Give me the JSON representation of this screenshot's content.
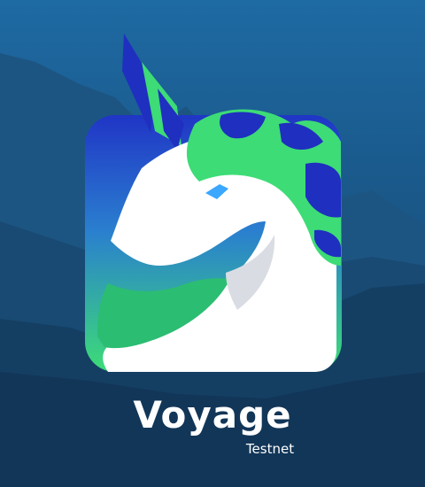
{
  "app": {
    "name": "Voyage",
    "subtitle": "Testnet"
  },
  "logo": {
    "icon": "unicorn-icon"
  },
  "colors": {
    "sky_top": "#1e6aa3",
    "sky_mid": "#16476e",
    "mountain_far": "#1e4f78",
    "mountain_near": "#123456",
    "logo_blue": "#1f2fbf",
    "logo_green": "#3ddc76",
    "logo_white": "#ffffff",
    "eye": "#3ba7ff"
  }
}
